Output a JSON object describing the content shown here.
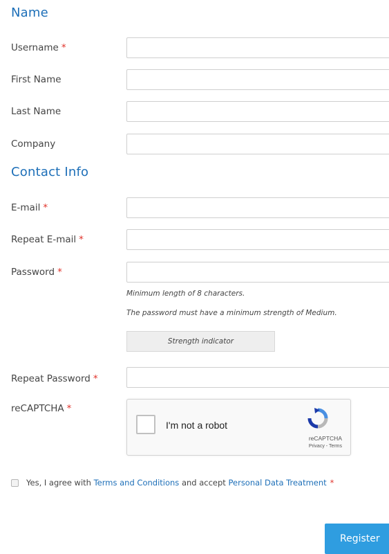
{
  "sections": {
    "name": "Name",
    "contact": "Contact Info"
  },
  "fields": {
    "username": {
      "label": "Username",
      "value": "",
      "required_mark": "*"
    },
    "first_name": {
      "label": "First Name",
      "value": ""
    },
    "last_name": {
      "label": "Last Name",
      "value": ""
    },
    "company": {
      "label": "Company",
      "value": ""
    },
    "email": {
      "label": "E-mail",
      "value": "",
      "required_mark": "*"
    },
    "repeat_email": {
      "label": "Repeat E-mail",
      "value": "",
      "required_mark": "*"
    },
    "password": {
      "label": "Password",
      "value": "",
      "required_mark": "*"
    },
    "repeat_password": {
      "label": "Repeat Password",
      "value": "",
      "required_mark": "*"
    },
    "recaptcha": {
      "label": "reCAPTCHA",
      "required_mark": "*"
    }
  },
  "password_hints": {
    "min_length": "Minimum length of 8 characters.",
    "strength_rule": "The password must have a minimum strength of Medium.",
    "strength_indicator": "Strength indicator"
  },
  "recaptcha": {
    "checkbox_label": "I'm not a robot",
    "brand": "reCAPTCHA",
    "privacy": "Privacy",
    "separator": " - ",
    "terms": "Terms",
    "checked": false
  },
  "consent": {
    "prefix": "Yes, I agree with ",
    "terms_link": "Terms and Conditions",
    "middle": " and accept ",
    "data_link": "Personal Data Treatment",
    "required_mark": "*",
    "checked": false
  },
  "register_button": "Register",
  "colors": {
    "accent": "#1d6fb8",
    "button": "#2f9de0",
    "required": "#e0322a"
  }
}
